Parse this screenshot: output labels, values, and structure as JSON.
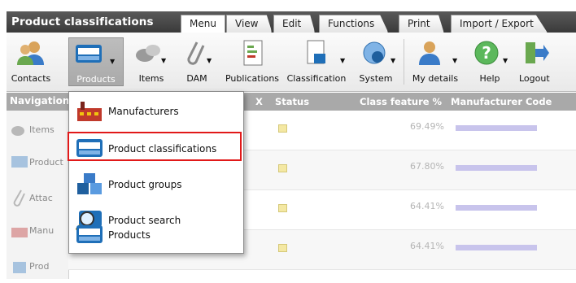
{
  "app": {
    "title": "Product classifications"
  },
  "tabs": [
    {
      "label": "Menu"
    },
    {
      "label": "View"
    },
    {
      "label": "Edit"
    },
    {
      "label": "Functions"
    },
    {
      "label": "Print"
    },
    {
      "label": "Import / Export"
    }
  ],
  "toolbar": {
    "buttons": [
      {
        "label": "Contacts",
        "icon": "contacts-icon"
      },
      {
        "label": "Products",
        "icon": "products-icon"
      },
      {
        "label": "Items",
        "icon": "items-icon"
      },
      {
        "label": "DAM",
        "icon": "paperclip-icon"
      },
      {
        "label": "Publications",
        "icon": "publications-icon"
      },
      {
        "label": "Classification",
        "icon": "classification-icon"
      },
      {
        "label": "System",
        "icon": "system-globe-icon"
      },
      {
        "label": "My details",
        "icon": "user-icon"
      },
      {
        "label": "Help",
        "icon": "help-icon"
      },
      {
        "label": "Logout",
        "icon": "logout-icon"
      }
    ]
  },
  "nav": {
    "title": "Navigation",
    "items": [
      {
        "label": "Items"
      },
      {
        "label": "Product"
      },
      {
        "label": "Attac"
      },
      {
        "label": "Manu"
      },
      {
        "label": "Prod"
      }
    ]
  },
  "grid": {
    "headers": {
      "x": "X",
      "status": "Status",
      "class_feature": "Class feature %",
      "manufacturer_code": "Manufacturer Code"
    },
    "rows": [
      {
        "class_feature": "69.49%"
      },
      {
        "class_feature": "67.80%"
      },
      {
        "class_feature": "64.41%"
      },
      {
        "class_feature": "64.41%"
      }
    ]
  },
  "menu": {
    "items": [
      {
        "label": "Manufacturers",
        "icon": "factory-icon"
      },
      {
        "label": "Product classifications",
        "icon": "product-classification-icon",
        "highlighted": true
      },
      {
        "label": "Product groups",
        "icon": "cubes-icon"
      },
      {
        "label": "Product search",
        "icon": "magnifier-icon"
      },
      {
        "label": "Products",
        "icon": "products-icon"
      }
    ]
  },
  "colors": {
    "accent_highlight": "#e11919",
    "header_bar": "#4a4a4a",
    "status_box": "#f4e8a3"
  }
}
